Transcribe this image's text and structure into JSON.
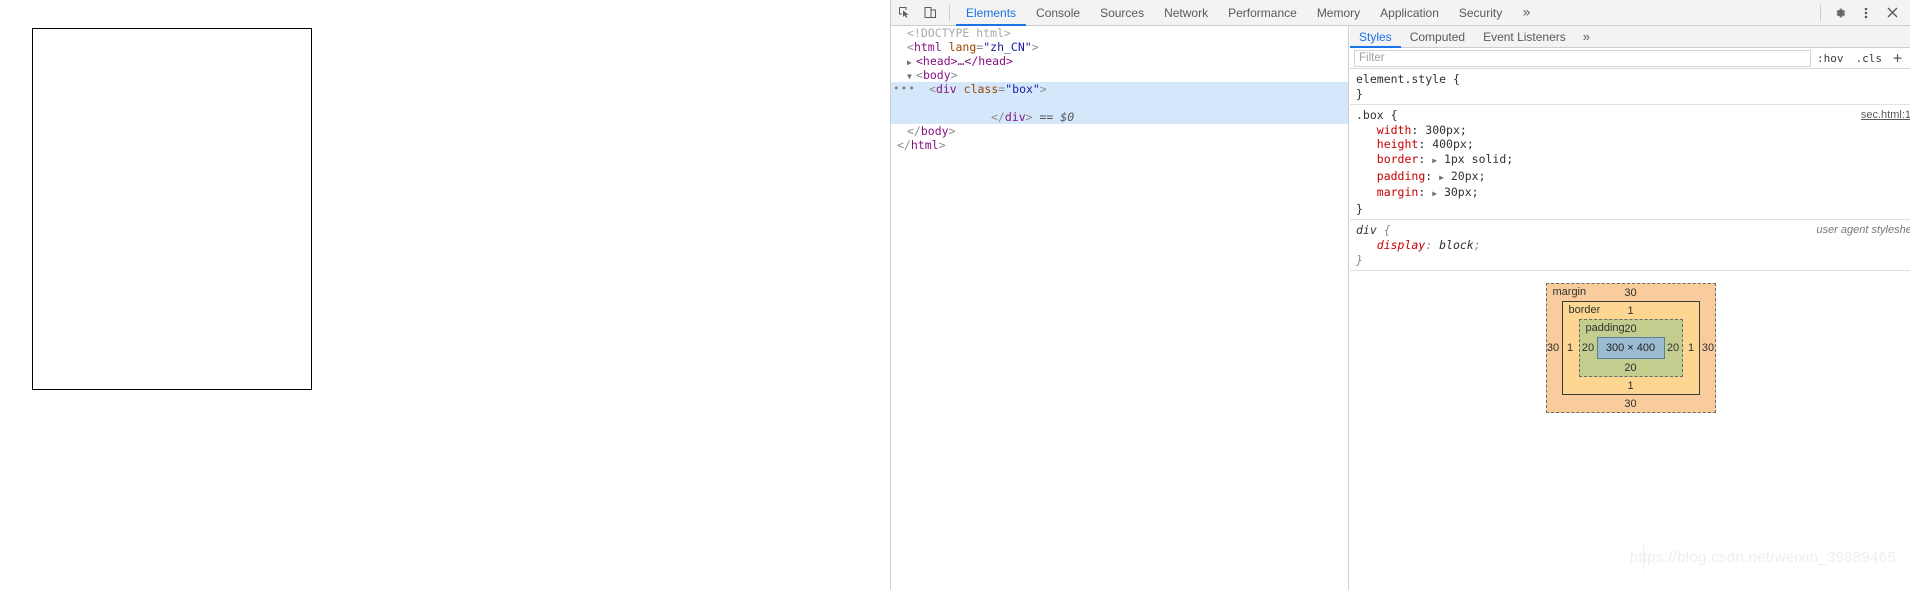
{
  "toolbar": {
    "inspect_icon": "inspect-cursor-icon",
    "device_icon": "device-toolbar-icon",
    "tabs": [
      {
        "label": "Elements",
        "active": true
      },
      {
        "label": "Console",
        "active": false
      },
      {
        "label": "Sources",
        "active": false
      },
      {
        "label": "Network",
        "active": false
      },
      {
        "label": "Performance",
        "active": false
      },
      {
        "label": "Memory",
        "active": false
      },
      {
        "label": "Application",
        "active": false
      },
      {
        "label": "Security",
        "active": false
      }
    ],
    "more_tabs": "»",
    "settings_icon": "gear-icon",
    "menu_icon": "kebab-menu-icon",
    "close_icon": "close-icon",
    "accent_color": "#1a73e8"
  },
  "dom": {
    "lines": [
      {
        "indent": 0,
        "disclosure": "",
        "type": "doctype",
        "text": "<!DOCTYPE html>"
      },
      {
        "indent": 0,
        "disclosure": "",
        "type": "open",
        "tag": "html",
        "attr": "lang",
        "value": "\"zh_CN\""
      },
      {
        "indent": 1,
        "disclosure": "▶",
        "type": "collapsed",
        "text": "<head>…</head>"
      },
      {
        "indent": 1,
        "disclosure": "▼",
        "type": "open",
        "tag": "body"
      },
      {
        "indent": 2,
        "disclosure": "",
        "type": "open",
        "tag": "div",
        "attr": "class",
        "value": "\"box\"",
        "selected": true,
        "dots": "•••"
      },
      {
        "indent": 2,
        "disclosure": "",
        "type": "blank",
        "selected": true
      },
      {
        "indent": 4,
        "disclosure": "",
        "type": "close-sel",
        "text": "</div>",
        "suffix": " == $0",
        "selected": true
      },
      {
        "indent": 1,
        "disclosure": "",
        "type": "close",
        "text": "</body>"
      },
      {
        "indent": 0,
        "disclosure": "",
        "type": "close",
        "text": "</html>"
      }
    ]
  },
  "styles": {
    "tabs": [
      {
        "label": "Styles",
        "active": true
      },
      {
        "label": "Computed",
        "active": false
      },
      {
        "label": "Event Listeners",
        "active": false
      }
    ],
    "more_tabs": "»",
    "filter_placeholder": "Filter",
    "filter_value": "",
    "hov_label": ":hov",
    "cls_label": ".cls",
    "plus_label": "+",
    "rules": [
      {
        "selector": "element.style",
        "source": "",
        "declarations": []
      },
      {
        "selector": ".box",
        "source": "sec.html:1",
        "declarations": [
          {
            "prop": "width",
            "value": "300px",
            "expandable": false
          },
          {
            "prop": "height",
            "value": "400px",
            "expandable": false
          },
          {
            "prop": "border",
            "value": "1px solid",
            "expandable": true
          },
          {
            "prop": "padding",
            "value": "20px",
            "expandable": true
          },
          {
            "prop": "margin",
            "value": "30px",
            "expandable": true
          }
        ]
      },
      {
        "selector": "div",
        "source": "user agent stylesheet",
        "user_agent": true,
        "declarations": [
          {
            "prop": "display",
            "value": "block",
            "expandable": false
          }
        ]
      }
    ]
  },
  "box_model": {
    "margin_label": "margin",
    "margin_top": "30",
    "margin_right": "30",
    "margin_bottom": "30",
    "margin_left": "30",
    "border_label": "border",
    "border_top": "1",
    "border_right": "1",
    "border_bottom": "1",
    "border_left": "1",
    "padding_label": "padding",
    "padding_top": "20",
    "padding_right": "20",
    "padding_bottom": "20",
    "padding_left": "20",
    "content_size": "300 × 400",
    "colors": {
      "margin": "#f9cc9d",
      "border": "#fdd791",
      "padding": "#c3cd8e",
      "content": "#9bbcd0"
    }
  },
  "page": {
    "box_border_color": "#000000"
  },
  "watermark": {
    "text": "https://blog.csdn.net/weixin_39889465"
  }
}
